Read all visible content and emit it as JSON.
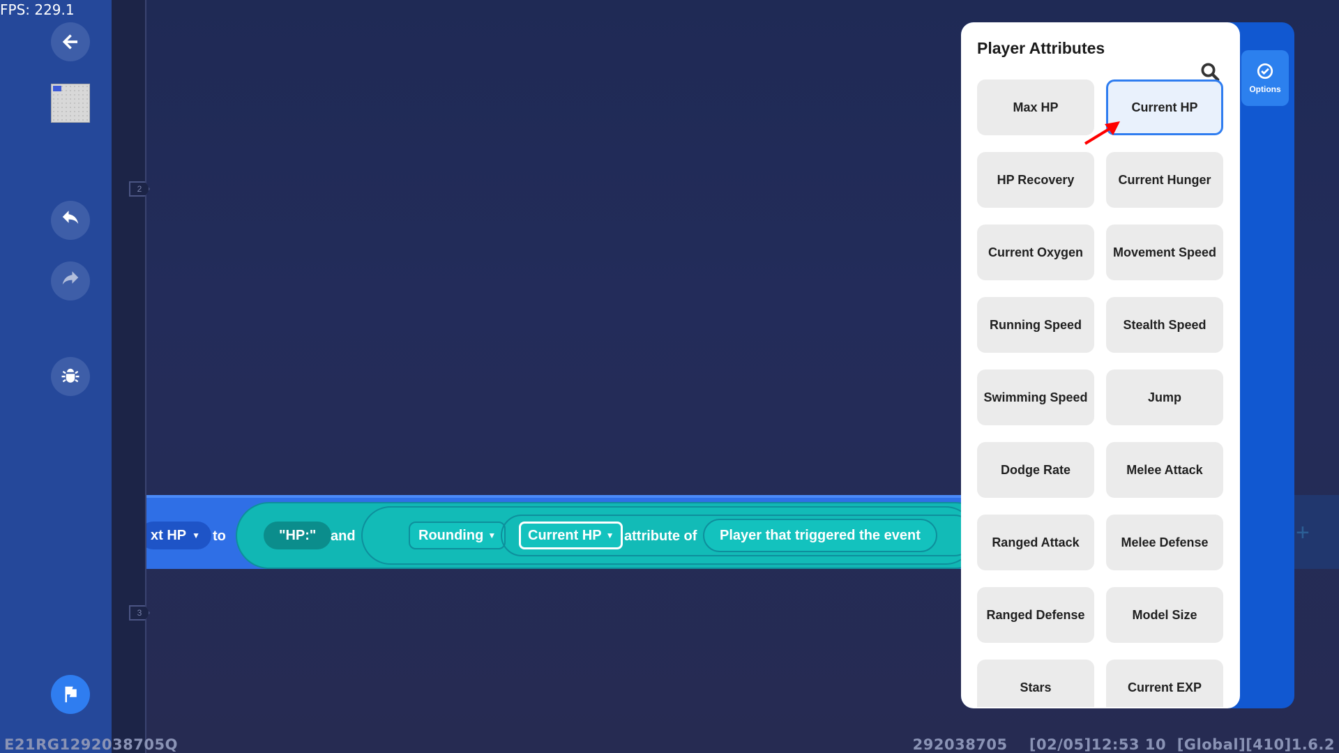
{
  "overlay": {
    "fps": "FPS: 229.1"
  },
  "sidebar": {
    "buttons": [
      {
        "name": "back",
        "icon": "arrow-left-icon"
      },
      {
        "name": "undo",
        "icon": "undo-icon"
      },
      {
        "name": "redo",
        "icon": "redo-icon"
      },
      {
        "name": "debug",
        "icon": "bug-icon"
      },
      {
        "name": "run",
        "icon": "flag-icon"
      }
    ]
  },
  "editor": {
    "line_numbers": [
      "2",
      "3"
    ],
    "block": {
      "variable": "xt HP",
      "to": "to",
      "string": "\"HP:\"",
      "and": "and",
      "rounding": "Rounding",
      "attribute": "Current HP",
      "attribute_of": "attribute of",
      "target": "Player that triggered the event"
    },
    "add_symbol": "+"
  },
  "panel": {
    "title": "Player Attributes",
    "options_label": "Options",
    "selected": "Current HP",
    "items": [
      "Max HP",
      "Current HP",
      "HP Recovery",
      "Current Hunger",
      "Current Oxygen",
      "Movement Speed",
      "Running Speed",
      "Stealth Speed",
      "Swimming Speed",
      "Jump",
      "Dodge Rate",
      "Melee Attack",
      "Ranged Attack",
      "Melee Defense",
      "Ranged Defense",
      "Model Size",
      "Stars",
      "Current EXP"
    ]
  },
  "footer": {
    "left": "E21RG1292038705Q",
    "right": "292038705    [02/05]12:53 10  [Global][410]1.6.2"
  },
  "colors": {
    "accent": "#2f7df0",
    "block_blue": "#2f6fe6",
    "block_teal": "#11b7b4",
    "annotation_red": "#ff0000"
  }
}
